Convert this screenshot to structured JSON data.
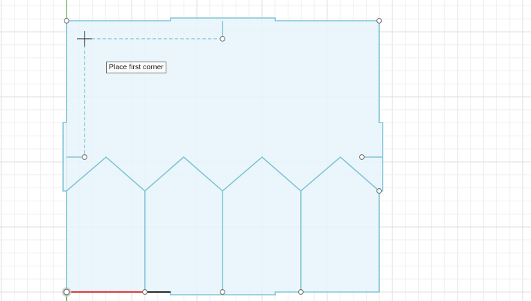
{
  "canvas": {
    "background": "#ffffff",
    "grid_minor_color": "#eeeeee",
    "grid_major_color": "#dedede",
    "sketch_line_color": "#7ec4d3",
    "sketch_fill_color": "#e6f4fb",
    "x_axis_color": "#d93b3b",
    "y_axis_color": "#4caf50",
    "x_axis_overlay_color": "#222222",
    "construction_line_style": "dashed"
  },
  "cursor": {
    "icon": "crosshair-cursor-icon"
  },
  "tooltip": {
    "text": "Place first corner"
  },
  "origin": {
    "icon": "sketch-origin-icon"
  }
}
